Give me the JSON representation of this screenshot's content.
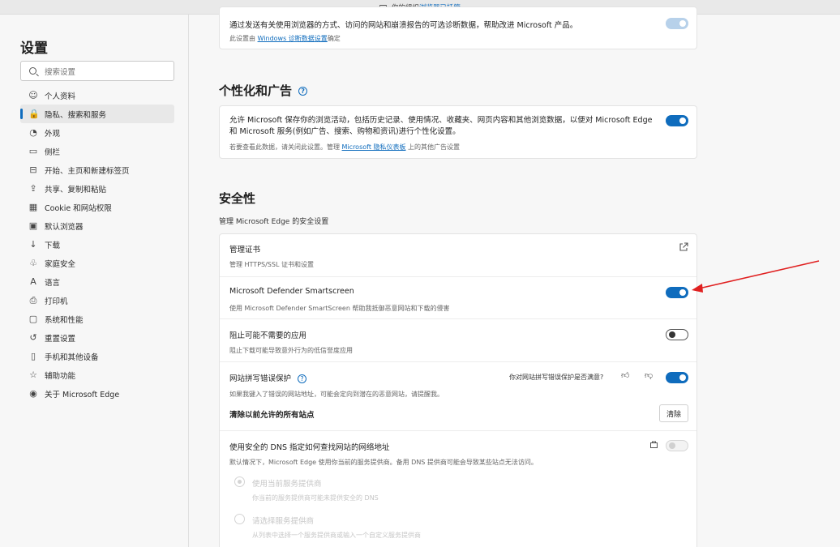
{
  "topbar": {
    "prefix": "你的组织",
    "link": "浏览器已托管"
  },
  "sidebar": {
    "title": "设置",
    "search_placeholder": "搜索设置",
    "items": [
      {
        "label": "个人资料",
        "icon": "profile-icon",
        "glyph": "☺"
      },
      {
        "label": "隐私、搜索和服务",
        "icon": "lock-icon",
        "glyph": "🔒",
        "active": true
      },
      {
        "label": "外观",
        "icon": "appearance-icon",
        "glyph": "◔"
      },
      {
        "label": "侧栏",
        "icon": "sidebar-icon",
        "glyph": "▭"
      },
      {
        "label": "开始、主页和新建标签页",
        "icon": "home-icon",
        "glyph": "⊟"
      },
      {
        "label": "共享、复制和粘贴",
        "icon": "share-icon",
        "glyph": "⇪"
      },
      {
        "label": "Cookie 和网站权限",
        "icon": "cookie-icon",
        "glyph": "▦"
      },
      {
        "label": "默认浏览器",
        "icon": "browser-icon",
        "glyph": "▣"
      },
      {
        "label": "下载",
        "icon": "download-icon",
        "glyph": "↓"
      },
      {
        "label": "家庭安全",
        "icon": "family-icon",
        "glyph": "♧"
      },
      {
        "label": "语言",
        "icon": "language-icon",
        "glyph": "A"
      },
      {
        "label": "打印机",
        "icon": "printer-icon",
        "glyph": "⎙"
      },
      {
        "label": "系统和性能",
        "icon": "system-icon",
        "glyph": "▢"
      },
      {
        "label": "重置设置",
        "icon": "reset-icon",
        "glyph": "↺"
      },
      {
        "label": "手机和其他设备",
        "icon": "phone-icon",
        "glyph": "▯"
      },
      {
        "label": "辅助功能",
        "icon": "accessibility-icon",
        "glyph": "☆"
      },
      {
        "label": "关于 Microsoft Edge",
        "icon": "edge-icon",
        "glyph": "◉"
      }
    ]
  },
  "top_card": {
    "title": "通过发送有关使用浏览器的方式、访问的网站和崩溃报告的可选诊断数据，帮助改进 Microsoft 产品。",
    "sub_prefix": "此设置由 ",
    "sub_link": "Windows 诊断数据设置",
    "sub_suffix": "确定"
  },
  "personalization": {
    "heading": "个性化和广告",
    "title": "允许 Microsoft 保存你的浏览活动，包括历史记录、使用情况、收藏夹、网页内容和其他浏览数据，以便对 Microsoft Edge 和 Microsoft 服务(例如广告、搜索、购物和资讯)进行个性化设置。",
    "sub_prefix": "若要查看此数据，请关闭此设置。管理 ",
    "sub_link": "Microsoft 隐私仪表板",
    "sub_suffix": " 上的其他广告设置"
  },
  "security": {
    "heading": "安全性",
    "subheading": "管理 Microsoft Edge 的安全设置",
    "cert": {
      "title": "管理证书",
      "sub": "管理 HTTPS/SSL 证书和设置"
    },
    "smartscreen": {
      "title": "Microsoft Defender Smartscreen",
      "sub": "使用 Microsoft Defender SmartScreen 帮助我抵御恶意网站和下载的侵害"
    },
    "pua": {
      "title": "阻止可能不需要的应用",
      "sub": "阻止下载可能导致意外行为的低信誉度应用"
    },
    "typo": {
      "title": "网站拼写错误保护",
      "feedback": "你对网站拼写错误保护是否满意?",
      "sub": "如果我键入了错误的网站地址，可能会定向到潜在的恶意网站，请提醒我。",
      "clear_title": "清除以前允许的所有站点",
      "clear_button": "清除"
    },
    "dns": {
      "title": "使用安全的 DNS 指定如何查找网站的网络地址",
      "sub": "默认情况下，Microsoft Edge 使用你当前的服务提供商。备用 DNS 提供商可能会导致某些站点无法访问。",
      "opt1_title": "使用当前服务提供商",
      "opt1_sub": "你当前的服务提供商可能未提供安全的 DNS",
      "opt2_title": "请选择服务提供商",
      "opt2_sub": "从列表中选择一个服务提供商或输入一个自定义服务提供商"
    }
  },
  "colors": {
    "accent": "#0f6cbd",
    "annotation_arrow": "#e02020"
  }
}
